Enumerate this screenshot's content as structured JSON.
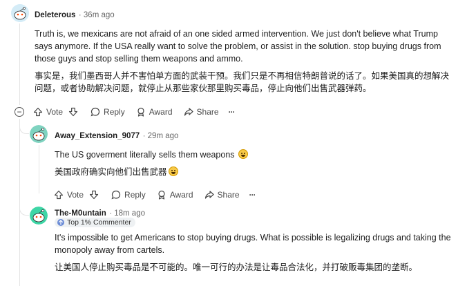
{
  "comments": [
    {
      "author": "Deleterous",
      "time": "· 36m ago",
      "avatar_color": "#6ab0de",
      "text_en": "Truth is, we mexicans are not afraid of an one sided armed intervention. We just don't believe what Trump says anymore. If the USA really want to solve the problem, or assist in the solution. stop buying drugs from those guys and stop selling them weapons and ammo.",
      "text_zh": "事实是，我们墨西哥人并不害怕单方面的武装干预。我们只是不再相信特朗普说的话了。如果美国真的想解决问题，或者协助解决问题，就停止从那些家伙那里购买毒品，停止向他们出售武器弹药。",
      "actions": {
        "vote": "Vote",
        "reply": "Reply",
        "award": "Award",
        "share": "Share",
        "more": "···"
      }
    },
    {
      "author": "Away_Extension_9077",
      "time": "· 29m ago",
      "avatar_color": "#5fc0a8",
      "text_en": "The US goverment literally sells them weapons",
      "text_zh": "美国政府确实向他们出售武器",
      "actions": {
        "vote": "Vote",
        "reply": "Reply",
        "award": "Award",
        "share": "Share",
        "more": "···"
      }
    },
    {
      "author": "The-M0untain",
      "time": "· 18m ago",
      "avatar_color": "#3ed6a6",
      "badge": "Top 1% Commenter",
      "text_en": "It's impossible to get Americans to stop buying drugs. What is possible is legalizing drugs and taking the monopoly away from cartels.",
      "text_zh": "让美国人停止购买毒品是不可能的。唯一可行的办法是让毒品合法化，并打破贩毒集团的垄断。"
    }
  ],
  "collapse_symbol": "−"
}
